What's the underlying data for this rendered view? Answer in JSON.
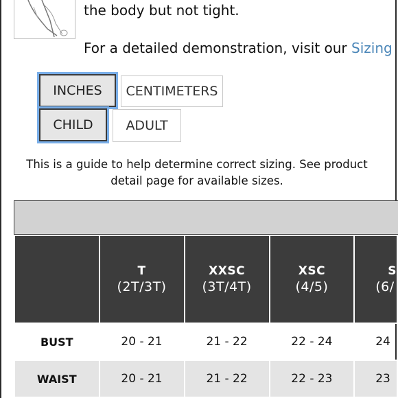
{
  "description": {
    "line1": "the body but not tight.",
    "line2_text": "For a detailed demonstration, visit our ",
    "line2_link": "Sizing"
  },
  "unit_toggle": {
    "inches": "INCHES",
    "centimeters": "CENTIMETERS",
    "selected": "INCHES"
  },
  "group_toggle": {
    "child": "CHILD",
    "adult": "ADULT",
    "selected": "CHILD"
  },
  "guide_text": {
    "line1": "This is a guide to help determine correct sizing. See product",
    "line2": "detail page for available sizes."
  },
  "size_table": {
    "columns": [
      {
        "code": "",
        "age": ""
      },
      {
        "code": "T",
        "age": "(2T/3T)"
      },
      {
        "code": "XXSC",
        "age": "(3T/4T)"
      },
      {
        "code": "XSC",
        "age": "(4/5)"
      },
      {
        "code": "S",
        "age": "(6/"
      }
    ],
    "rows": [
      {
        "label": "BUST",
        "values": [
          "20 - 21",
          "21 - 22",
          "22 - 24",
          "24"
        ]
      },
      {
        "label": "WAIST",
        "values": [
          "20 - 21",
          "21 - 22",
          "22 - 23",
          "23"
        ]
      }
    ]
  },
  "colors": {
    "header_dark": "#3c3c3c",
    "link_blue": "#4a86b8",
    "focus_ring": "#79aee8",
    "band_grey": "#d2d2d2",
    "row_alt": "#e4e4e4"
  }
}
